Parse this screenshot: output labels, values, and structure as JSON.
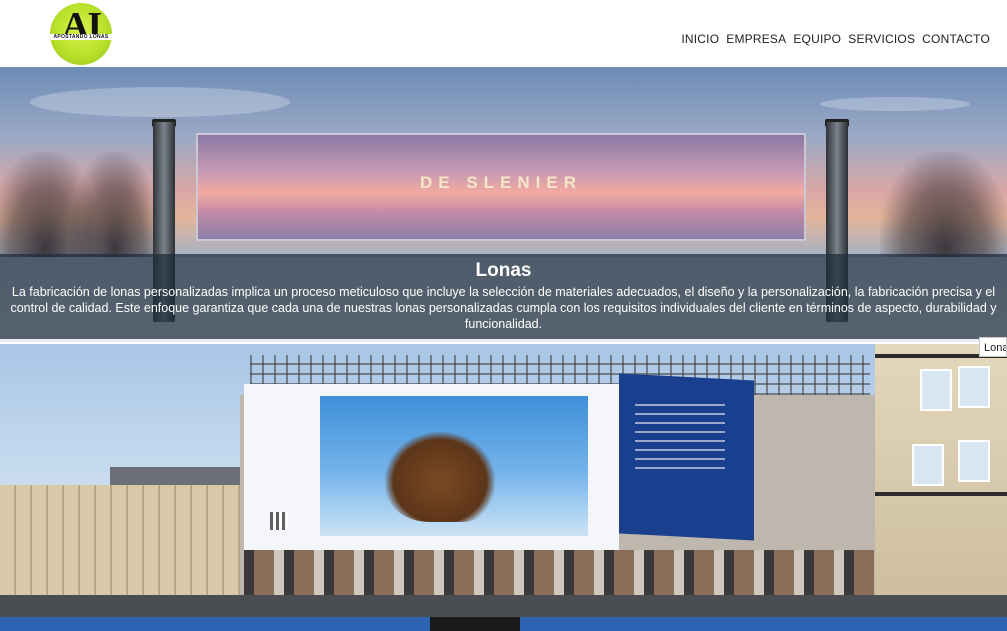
{
  "header": {
    "logo": {
      "letters": "AI",
      "text": "APOSTANDO LONAS"
    },
    "nav": [
      "INICIO",
      "EMPRESA",
      "EQUIPO",
      "SERVICIOS",
      "CONTACTO"
    ]
  },
  "hero1": {
    "banner_text": "DE SLENIER",
    "caption_title": "Lonas",
    "caption_text": "La fabricación de lonas personalizadas implica un proceso meticuloso que incluye la selección de materiales adecuados, el diseño y la personalización, la fabricación precisa y el control de calidad. Este enfoque garantiza que cada una de nuestras lonas personalizadas cumpla con los requisitos individuales del cliente en términos de aspecto, durabilidad y funcionalidad."
  },
  "tooltip": "Lonas",
  "colors": {
    "logo_green": "#b9e12a",
    "caption_bg": "#1e2d3c",
    "billboard_blue": "#1b3f8f"
  }
}
